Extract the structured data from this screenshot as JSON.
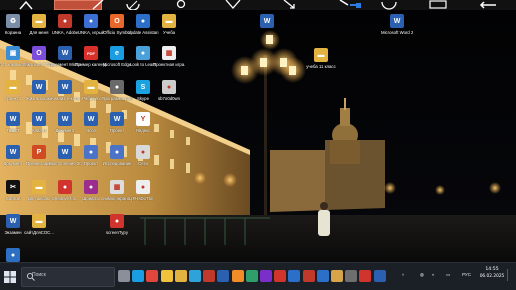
{
  "toolbar": {
    "buttons": [
      "screenshot-tool",
      "marker-tool",
      "pen-tool",
      "undo-tool",
      "circle-tool",
      "check-tool",
      "arrow-tool",
      "search-tool",
      "refresh-tool",
      "camera-tool",
      "exit-tool"
    ]
  },
  "desktop": {
    "col1": [
      {
        "label": "Корзина",
        "icon": "recycle-bin-icon",
        "color": "#7a8ea8"
      },
      {
        "label": "Этот компьютер",
        "icon": "computer-icon",
        "color": "#3b8ed6"
      },
      {
        "label": "проект2",
        "icon": "folder-icon",
        "color": "#e3b341"
      },
      {
        "label": "ТЕКСТ",
        "icon": "word-doc-icon",
        "color": "#2b5faf"
      },
      {
        "label": "Документ",
        "icon": "word-doc-icon",
        "color": "#2b5faf"
      },
      {
        "label": "CapCut",
        "icon": "capcut-icon",
        "color": "#111111"
      },
      {
        "label": "Экзамен",
        "icon": "word-doc-icon",
        "color": "#2b5faf"
      },
      {
        "label": "ГибридДата...",
        "icon": "app-icon",
        "color": "#2d6fc2"
      }
    ],
    "col2": [
      {
        "label": "Для меня",
        "icon": "folder-icon",
        "color": "#e3b341"
      },
      {
        "label": "Microsoft Office",
        "icon": "office-icon",
        "color": "#7b4dd8"
      },
      {
        "label": "Жизнь кошки",
        "icon": "word-doc-icon",
        "color": "#2b5faf"
      },
      {
        "label": "Анализ",
        "icon": "word-doc-icon",
        "color": "#2b5faf"
      },
      {
        "label": "Презентация",
        "icon": "powerpoint-icon",
        "color": "#d04a22"
      },
      {
        "label": "Для школы",
        "icon": "folder-icon",
        "color": "#e3b341"
      },
      {
        "label": "сайтДляСОС...",
        "icon": "folder-icon",
        "color": "#e3b341"
      }
    ],
    "col3": [
      {
        "label": "UNKA, Adobe",
        "icon": "app-icon",
        "color": "#c0392b"
      },
      {
        "label": "Документ Microsoft",
        "icon": "word-doc-icon",
        "color": "#2b5faf"
      },
      {
        "label": "Анализ текста",
        "icon": "word-doc-icon",
        "color": "#2b5faf"
      },
      {
        "label": "Документ",
        "icon": "word-doc-icon",
        "color": "#2b5faf"
      },
      {
        "label": "Выступление 2024",
        "icon": "word-doc-icon",
        "color": "#2b5faf"
      },
      {
        "label": "Onedrive for...",
        "icon": "app-icon",
        "color": "#d0342c"
      }
    ],
    "col4": [
      {
        "label": "UNKA, игрый",
        "icon": "app-icon",
        "color": "#3b6fd1"
      },
      {
        "label": "Пример календарь 2024 (2).pdf",
        "icon": "pdf-icon",
        "color": "#d9302b"
      },
      {
        "label": "Рабочую",
        "icon": "folder-icon",
        "color": "#e3b341"
      },
      {
        "label": "Эссе",
        "icon": "word-doc-icon",
        "color": "#2b5faf"
      },
      {
        "label": "Проект",
        "icon": "app-icon",
        "color": "#4b74c9"
      },
      {
        "label": "Шрифты",
        "icon": "app-icon",
        "color": "#9b2d8f"
      }
    ],
    "col5": [
      {
        "label": "Officiu Symbol",
        "icon": "office-icon",
        "color": "#e8672a"
      },
      {
        "label": "Microsoft Edge",
        "icon": "edge-icon",
        "color": "#1b9de2"
      },
      {
        "label": "Программа для",
        "icon": "app-icon",
        "color": "#6a6a6a"
      },
      {
        "label": "Проект",
        "icon": "word-doc-icon",
        "color": "#2b5faf"
      },
      {
        "label": "Исследование",
        "icon": "app-icon",
        "color": "#4b74c9"
      },
      {
        "label": "снимок экрана.png",
        "icon": "image-icon",
        "color": "#dddddd"
      },
      {
        "label": "screenTypy",
        "icon": "app-icon",
        "color": "#d0342c"
      }
    ],
    "col6": [
      {
        "label": "Update Assistan",
        "icon": "app-icon",
        "color": "#2b6fc9"
      },
      {
        "label": "Look to Learn",
        "icon": "app-icon",
        "color": "#4aa0d8"
      },
      {
        "label": "Skype",
        "icon": "skype-icon",
        "color": "#1aa1e0"
      },
      {
        "label": "Яндекс",
        "icon": "yandex-icon",
        "color": "#ffffff"
      },
      {
        "label": "Сети",
        "icon": "app-icon",
        "color": "#d9d9d9"
      },
      {
        "label": "FHsDoTbn",
        "icon": "app-icon",
        "color": "#eeeeee"
      }
    ],
    "col7": [
      {
        "label": "Учеба",
        "icon": "folder-icon",
        "color": "#e3b341"
      },
      {
        "label": "Проектная игра.png",
        "icon": "image-icon",
        "color": "#eeeeee"
      },
      {
        "label": "sb7o0d0wn",
        "icon": "app-icon",
        "color": "#cccccc"
      }
    ],
    "extra": [
      {
        "label": "",
        "icon": "word-doc-icon",
        "color": "#2b5faf"
      },
      {
        "label": "Microsoft Word 2013",
        "icon": "word-icon",
        "color": "#2b5faf"
      },
      {
        "label": "учеба 11 класс",
        "icon": "folder-icon",
        "color": "#e3b341"
      }
    ]
  },
  "taskbar": {
    "search_placeholder": "Поиск",
    "apps": [
      {
        "icon": "task-view-icon",
        "color": "#8a8f99"
      },
      {
        "icon": "edge-icon",
        "color": "#1b9de2"
      },
      {
        "icon": "chrome-icon",
        "color": "#e0463b"
      },
      {
        "icon": "yandex-browser-icon",
        "color": "#f0c23b"
      },
      {
        "icon": "explorer-icon",
        "color": "#e3b341"
      },
      {
        "icon": "telegram-icon",
        "color": "#2fa3d9"
      },
      {
        "icon": "app-icon",
        "color": "#c0392b"
      },
      {
        "icon": "word-icon",
        "color": "#2b5faf"
      },
      {
        "icon": "app-icon",
        "color": "#f28c28"
      },
      {
        "icon": "app-icon",
        "color": "#2f9e6b"
      },
      {
        "icon": "app-icon",
        "color": "#7a2fc8"
      },
      {
        "icon": "app-icon",
        "color": "#d0342c"
      },
      {
        "icon": "app-icon",
        "color": "#2b6fc9"
      },
      {
        "icon": "app-icon",
        "color": "#c0392b"
      },
      {
        "icon": "app-icon",
        "color": "#2b6fc9"
      },
      {
        "icon": "app-icon",
        "color": "#d6a54a"
      },
      {
        "icon": "app-icon",
        "color": "#6e6e6e"
      },
      {
        "icon": "app-icon",
        "color": "#d0342c"
      },
      {
        "icon": "app-icon",
        "color": "#2b5faf"
      }
    ],
    "tray": {
      "language": "РУС",
      "time": "14:55",
      "date": "06.02.2025"
    }
  }
}
